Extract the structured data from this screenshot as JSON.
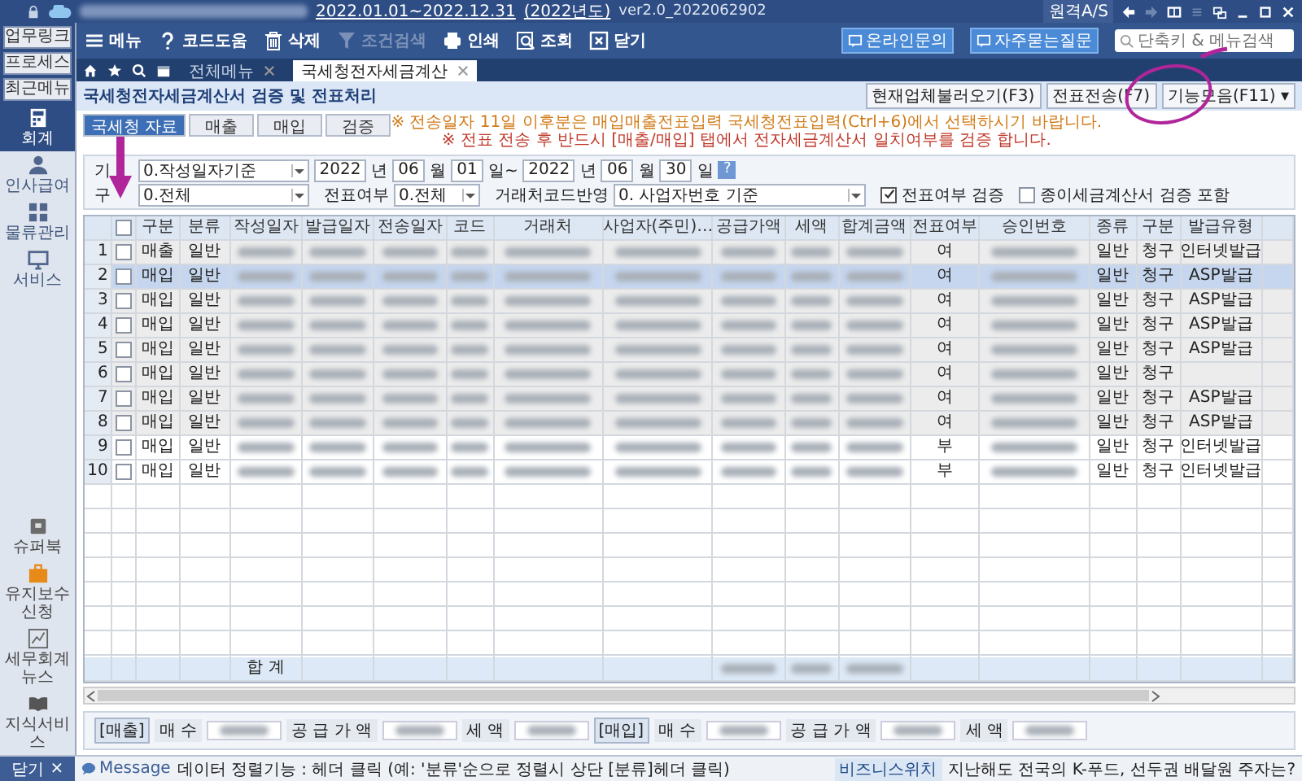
{
  "title_bar": {
    "period": "2022.01.01~2022.12.31",
    "year": "(2022년도)",
    "version": "ver2.0_2022062902",
    "remote": "원격A/S"
  },
  "quick_links": [
    {
      "label": "업무링크"
    },
    {
      "label": "프로세스"
    },
    {
      "label": "최근메뉴"
    }
  ],
  "toolbar": [
    {
      "label": "메뉴",
      "kind": "menu",
      "disabled": false
    },
    {
      "label": "코드도움",
      "kind": "help",
      "disabled": false
    },
    {
      "label": "삭제",
      "kind": "trash",
      "disabled": false
    },
    {
      "label": "조건검색",
      "kind": "filter",
      "disabled": true
    },
    {
      "label": "인쇄",
      "kind": "print",
      "disabled": false
    },
    {
      "label": "조회",
      "kind": "view",
      "disabled": false
    },
    {
      "label": "닫기",
      "kind": "close",
      "disabled": false
    }
  ],
  "support_buttons": [
    "온라인문의",
    "자주묻는질문"
  ],
  "search": {
    "placeholder": "단축키 & 메뉴검색"
  },
  "tabs": [
    {
      "label": "전체메뉴",
      "selected": false
    },
    {
      "label": "국세청전자세금계산",
      "selected": true
    }
  ],
  "sidebar": {
    "items": [
      {
        "label": "회계",
        "kind": "calc",
        "selected": true
      },
      {
        "label": "인사급여",
        "kind": "person",
        "selected": false
      },
      {
        "label": "물류관리",
        "kind": "grid",
        "selected": false
      },
      {
        "label": "서비스",
        "kind": "monitor",
        "selected": false
      }
    ],
    "bottom_items": [
      {
        "label": "슈퍼북",
        "kind": "book"
      },
      {
        "label": "유지보수신청",
        "kind": "bag"
      },
      {
        "label": "세무회계뉴스",
        "kind": "news"
      },
      {
        "label": "지식서비스",
        "kind": "open-book"
      }
    ]
  },
  "page": {
    "title": "국세청전자세금계산서 검증 및 전표처리",
    "buttons": [
      "현재업체불러오기(F3)",
      "전표전송(F7)",
      "기능모음(F11) ▾"
    ]
  },
  "sub_tabs": [
    {
      "label": "국세청 자료",
      "selected": true
    },
    {
      "label": "매출",
      "selected": false
    },
    {
      "label": "매입",
      "selected": false
    },
    {
      "label": "검증",
      "selected": false
    }
  ],
  "notices": [
    "※ 전송일자 11일 이후분은 매입매출전표입력 국세청전표입력(Ctrl+6)에서 선택하시기 바랍니다.",
    "※ 전표 전송 후 반드시 [매출/매입] 탭에서 전자세금계산서 일치여부를 검증 합니다."
  ],
  "filters": {
    "period_label": "기",
    "period_basis": "0.작성일자기준",
    "from_year": "2022",
    "from_year_unit": "년",
    "from_month": "06",
    "from_month_unit": "월",
    "from_day": "01",
    "from_day_unit": "일~",
    "to_year": "2022",
    "to_year_unit": "년",
    "to_month": "06",
    "to_month_unit": "월",
    "to_day": "30",
    "to_day_unit": "일",
    "help": "?",
    "type_label": "구",
    "type_value": "0.전체",
    "voucher_label": "전표여부",
    "voucher_value": "0.전체",
    "code_label": "거래처코드반영",
    "code_value": "0. 사업자번호 기준",
    "checks": [
      {
        "label": "전표여부 검증",
        "checked": true
      },
      {
        "label": "종이세금계산서 검증 포함",
        "checked": false
      }
    ]
  },
  "table": {
    "columns": [
      {
        "kind": "number"
      },
      {
        "kind": "check",
        "checked": false
      },
      {
        "kind": "text",
        "label": "구분"
      },
      {
        "kind": "text",
        "label": "분류"
      },
      {
        "kind": "redacted",
        "label": "작성일자"
      },
      {
        "kind": "redacted",
        "label": "발급일자"
      },
      {
        "kind": "redacted",
        "label": "전송일자"
      },
      {
        "kind": "redacted",
        "label": "코드"
      },
      {
        "kind": "redacted",
        "label": "거래처"
      },
      {
        "kind": "redacted",
        "label": "사업자(주민)…"
      },
      {
        "kind": "redacted",
        "label": "공급가액"
      },
      {
        "kind": "redacted",
        "label": "세액"
      },
      {
        "kind": "redacted",
        "label": "합계금액"
      },
      {
        "kind": "text",
        "label": "전표여부"
      },
      {
        "kind": "redacted",
        "label": "승인번호"
      },
      {
        "kind": "text",
        "label": "종류"
      },
      {
        "kind": "text",
        "label": "구분"
      },
      {
        "kind": "text",
        "label": "발급유형"
      },
      {
        "kind": "blank"
      }
    ],
    "rows": [
      {
        "cells": [
          "1",
          "",
          "매출",
          "일반",
          "",
          "",
          "",
          "",
          "",
          "",
          "",
          "",
          "",
          "여",
          "",
          "일반",
          "청구",
          "인터넷발급",
          ""
        ],
        "checked": false,
        "selected": false,
        "shaded": true
      },
      {
        "cells": [
          "2",
          "",
          "매입",
          "일반",
          "",
          "",
          "",
          "",
          "",
          "",
          "",
          "",
          "",
          "여",
          "",
          "일반",
          "청구",
          "ASP발급",
          ""
        ],
        "checked": false,
        "selected": true,
        "shaded": true
      },
      {
        "cells": [
          "3",
          "",
          "매입",
          "일반",
          "",
          "",
          "",
          "",
          "",
          "",
          "",
          "",
          "",
          "여",
          "",
          "일반",
          "청구",
          "ASP발급",
          ""
        ],
        "checked": false,
        "selected": false,
        "shaded": true
      },
      {
        "cells": [
          "4",
          "",
          "매입",
          "일반",
          "",
          "",
          "",
          "",
          "",
          "",
          "",
          "",
          "",
          "여",
          "",
          "일반",
          "청구",
          "ASP발급",
          ""
        ],
        "checked": false,
        "selected": false,
        "shaded": true
      },
      {
        "cells": [
          "5",
          "",
          "매입",
          "일반",
          "",
          "",
          "",
          "",
          "",
          "",
          "",
          "",
          "",
          "여",
          "",
          "일반",
          "청구",
          "ASP발급",
          ""
        ],
        "checked": false,
        "selected": false,
        "shaded": true
      },
      {
        "cells": [
          "6",
          "",
          "매입",
          "일반",
          "",
          "",
          "",
          "",
          "",
          "",
          "",
          "",
          "",
          "여",
          "",
          "일반",
          "청구",
          "",
          ""
        ],
        "checked": false,
        "selected": false,
        "shaded": true
      },
      {
        "cells": [
          "7",
          "",
          "매입",
          "일반",
          "",
          "",
          "",
          "",
          "",
          "",
          "",
          "",
          "",
          "여",
          "",
          "일반",
          "청구",
          "ASP발급",
          ""
        ],
        "checked": false,
        "selected": false,
        "shaded": true
      },
      {
        "cells": [
          "8",
          "",
          "매입",
          "일반",
          "",
          "",
          "",
          "",
          "",
          "",
          "",
          "",
          "",
          "여",
          "",
          "일반",
          "청구",
          "ASP발급",
          ""
        ],
        "checked": false,
        "selected": false,
        "shaded": true
      },
      {
        "cells": [
          "9",
          "",
          "매입",
          "일반",
          "",
          "",
          "",
          "",
          "",
          "",
          "",
          "",
          "",
          "부",
          "",
          "일반",
          "청구",
          "인터넷발급",
          ""
        ],
        "checked": false,
        "selected": false,
        "shaded": false
      },
      {
        "cells": [
          "10",
          "",
          "매입",
          "일반",
          "",
          "",
          "",
          "",
          "",
          "",
          "",
          "",
          "",
          "부",
          "",
          "일반",
          "청구",
          "인터넷발급",
          ""
        ],
        "checked": false,
        "selected": false,
        "shaded": false
      }
    ],
    "total_label": "합 계"
  },
  "summary": [
    {
      "kind": "group",
      "label": "[매출]"
    },
    {
      "kind": "label",
      "label": "매 수"
    },
    {
      "kind": "label",
      "label": "공 급 가 액"
    },
    {
      "kind": "label",
      "label": "세 액"
    },
    {
      "kind": "group",
      "label": "[매입]"
    },
    {
      "kind": "label",
      "label": "매 수"
    },
    {
      "kind": "label",
      "label": "공 급 가 액"
    },
    {
      "kind": "label",
      "label": "세 액"
    }
  ],
  "status_bar": {
    "close": "닫기",
    "close_icon": "×",
    "message_label": "Message",
    "message": "데이터 정렬기능 : 헤더 클릭 (예: '분류'순으로 정렬시 상단 [분류]헤더 클릭)",
    "news_label": "비즈니스위치",
    "news": "지난해도 전국의 K-푸드, 선두권 배달원 주자는?"
  }
}
